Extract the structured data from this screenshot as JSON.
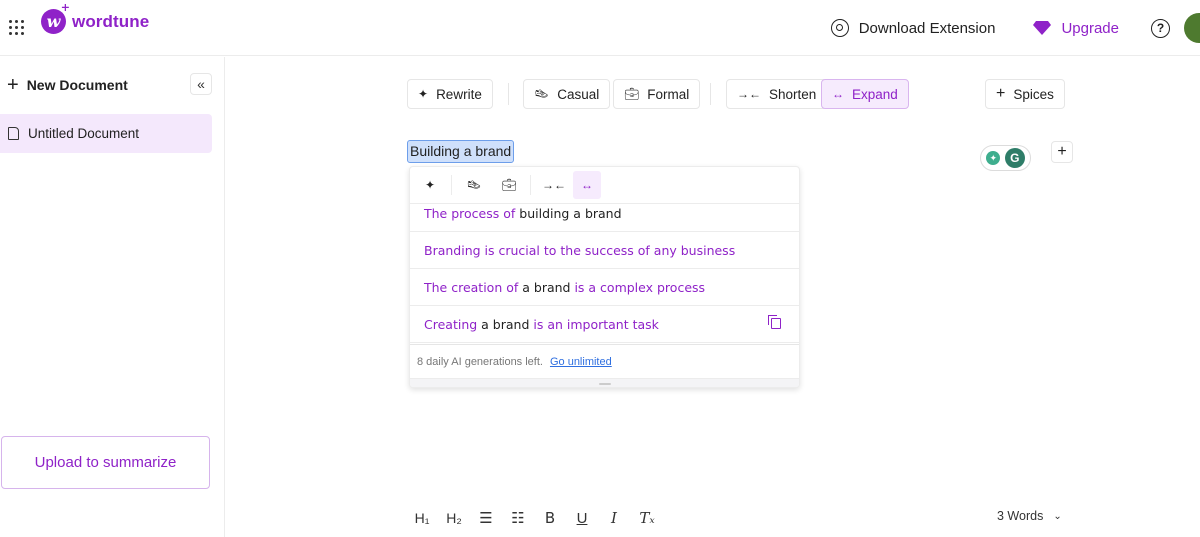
{
  "app": {
    "brand": "wordtune",
    "brand_color": "#8f22c8",
    "logo_letter": "w"
  },
  "header": {
    "download_extension": "Download Extension",
    "upgrade": "Upgrade",
    "help_glyph": "?"
  },
  "sidebar": {
    "new_document": "New Document",
    "collapse_glyph": "«",
    "documents": [
      {
        "title": "Untitled Document",
        "active": true
      }
    ],
    "upload_button": "Upload to summarize"
  },
  "toolbar": {
    "rewrite": "Rewrite",
    "casual": "Casual",
    "formal": "Formal",
    "shorten": "Shorten",
    "expand": "Expand",
    "spices": "Spices",
    "active": "Expand"
  },
  "editor": {
    "selected_text": "Building a brand",
    "add_block_glyph": "+"
  },
  "popup": {
    "suggestions": [
      {
        "parts": [
          {
            "text": "The process of ",
            "changed": true
          },
          {
            "text": "building a brand",
            "changed": false
          }
        ]
      },
      {
        "parts": [
          {
            "text": "Branding is crucial to the success of any business",
            "changed": true
          }
        ]
      },
      {
        "parts": [
          {
            "text": "The creation of ",
            "changed": true
          },
          {
            "text": "a brand",
            "changed": false
          },
          {
            "text": " is a complex process",
            "changed": true
          }
        ]
      },
      {
        "parts": [
          {
            "text": "Creating",
            "changed": true
          },
          {
            "text": " a brand",
            "changed": false
          },
          {
            "text": " is an important task",
            "changed": true
          }
        ],
        "show_copy": true
      }
    ],
    "footer_text": "8 daily AI generations left.",
    "footer_link": "Go unlimited"
  },
  "format_bar": {
    "h1": "H₁",
    "h2": "H₂",
    "bullet_list": "☰",
    "numbered_list": "☷",
    "bold": "B",
    "underline": "U",
    "italic": "I",
    "clear_format": "Tₓ"
  },
  "status": {
    "word_count": "3 Words"
  }
}
